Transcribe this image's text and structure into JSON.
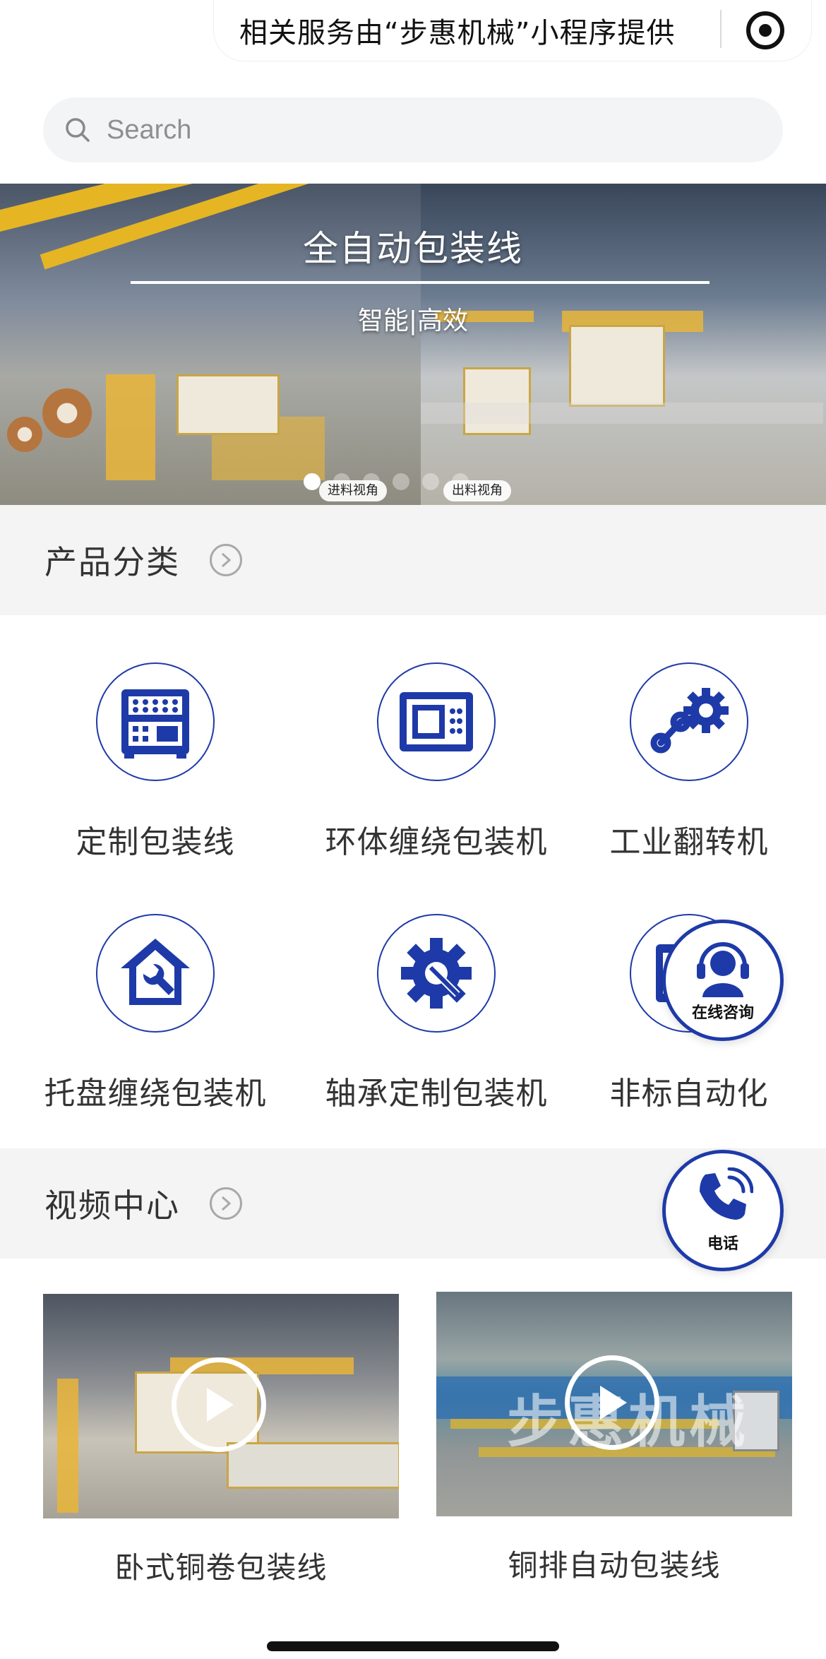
{
  "capsule": {
    "text": "相关服务由“步惠机械”小程序提供",
    "icon": "target-icon"
  },
  "search": {
    "placeholder": "Search",
    "icon": "search-icon"
  },
  "banner": {
    "title": "全自动包装线",
    "subtitle": "智能|高效",
    "left_tag": "进料视角",
    "right_tag": "出料视角",
    "slide_count": 6,
    "active_slide": 0
  },
  "categories_section": {
    "title": "产品分类",
    "icon": "chevron-right-circle-icon"
  },
  "categories": [
    {
      "label": "定制包装线",
      "icon": "machine-panel-icon"
    },
    {
      "label": "环体缠绕包装机",
      "icon": "control-box-icon"
    },
    {
      "label": "工业翻转机",
      "icon": "gear-chain-icon"
    },
    {
      "label": "托盘缠绕包装机",
      "icon": "house-wrench-icon"
    },
    {
      "label": "轴承定制包装机",
      "icon": "gear-wrench-icon"
    },
    {
      "label": "非标自动化",
      "icon": "device-icon"
    }
  ],
  "floats": {
    "consult_label": "在线咨询",
    "phone_label": "电话"
  },
  "video_section": {
    "title": "视频中心",
    "icon": "chevron-right-circle-icon"
  },
  "videos": [
    {
      "label": "卧式铜卷包装线",
      "icon": "play-icon"
    },
    {
      "label": "铜排自动包装线",
      "icon": "play-icon",
      "watermark": "步惠机械"
    }
  ],
  "colors": {
    "brand_blue": "#1e3aa8",
    "section_bg": "#f4f4f4"
  }
}
